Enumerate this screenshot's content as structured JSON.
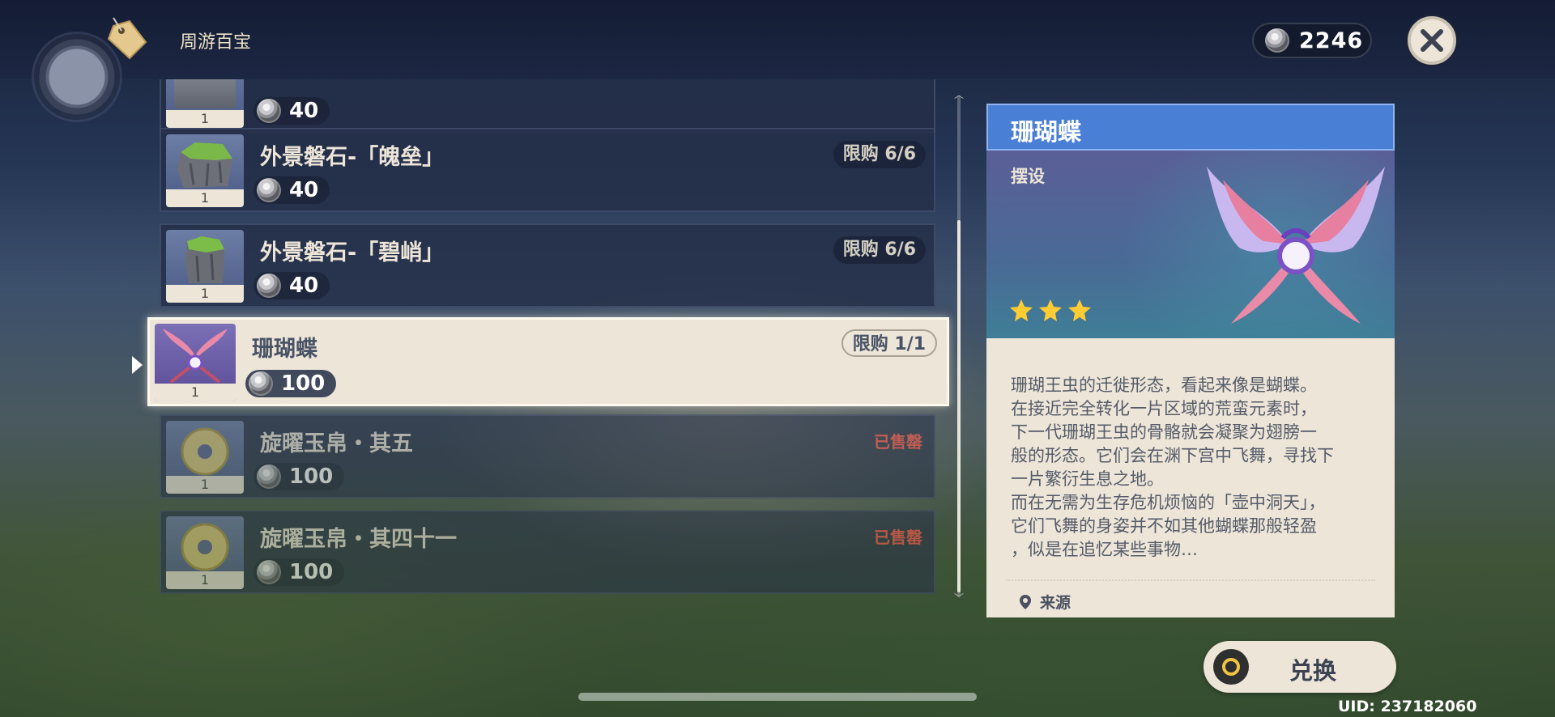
{
  "header": {
    "title": "周游百宝",
    "currency_amount": "2246"
  },
  "items": [
    {
      "name": "",
      "qty": "1",
      "price": "40",
      "limit": "",
      "sold_out": false
    },
    {
      "name": "外景磐石-「魄垒」",
      "qty": "1",
      "price": "40",
      "limit": "限购 6/6",
      "sold_out": false
    },
    {
      "name": "外景磐石-「碧峭」",
      "qty": "1",
      "price": "40",
      "limit": "限购 6/6",
      "sold_out": false
    },
    {
      "name": "珊瑚蝶",
      "qty": "1",
      "price": "100",
      "limit": "限购 1/1",
      "sold_out": false,
      "selected": true
    },
    {
      "name": "旋曜玉帛・其五",
      "qty": "1",
      "price": "100",
      "limit": "",
      "sold_out": true,
      "sold_out_label": "已售罄"
    },
    {
      "name": "旋曜玉帛・其四十一",
      "qty": "1",
      "price": "100",
      "limit": "",
      "sold_out": true,
      "sold_out_label": "已售罄"
    }
  ],
  "detail": {
    "title": "珊瑚蝶",
    "category": "摆设",
    "rarity": 3,
    "description": "珊瑚王虫的迁徙形态，看起来像是蝴蝶。\n在接近完全转化一片区域的荒蛮元素时，\n下一代珊瑚王虫的骨骼就会凝聚为翅膀一\n般的形态。它们会在渊下宫中飞舞，寻找下\n一片繁衍生息之地。\n而在无需为生存危机烦恼的「壶中洞天」，\n它们飞舞的身姿并不如其他蝴蝶那般轻盈\n，似是在追忆某些事物…",
    "source_label": "来源"
  },
  "exchange_button": {
    "label": "兑换"
  },
  "uid_text": "UID: 237182060",
  "colors": {
    "panel_header": "#4a7fd6",
    "cream": "#ece5d8",
    "sold_out_red": "#ff5a4a",
    "star_gold": "#ffcc33"
  }
}
